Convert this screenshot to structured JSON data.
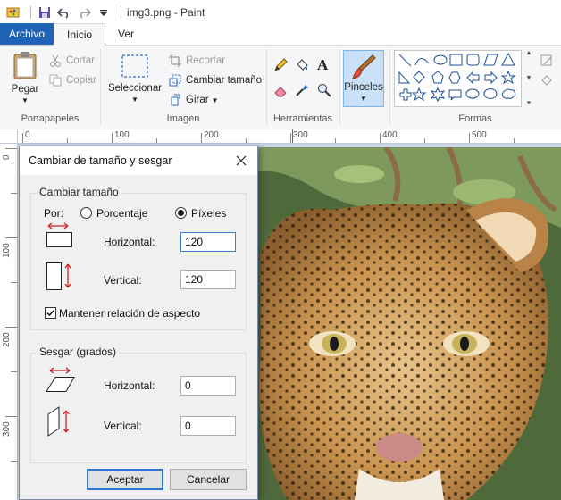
{
  "window": {
    "title": "img3.png - Paint"
  },
  "tabs": [
    {
      "label": "Archivo"
    },
    {
      "label": "Inicio"
    },
    {
      "label": "Ver"
    }
  ],
  "ribbon": {
    "clipboard": {
      "paste_label": "Pegar",
      "cut_label": "Cortar",
      "copy_label": "Copiar",
      "group_label": "Portapapeles"
    },
    "image": {
      "select_label": "Seleccionar",
      "crop_label": "Recortar",
      "resize_label": "Cambiar tamaño",
      "rotate_label": "Girar",
      "group_label": "Imagen"
    },
    "tools": {
      "group_label": "Herramientas"
    },
    "brushes": {
      "label": "Pinceles"
    },
    "shapes": {
      "group_label": "Formas"
    }
  },
  "rulers": {
    "top": [
      "0",
      "100",
      "200",
      "300",
      "400",
      "500"
    ],
    "left": [
      "0",
      "100",
      "200",
      "300"
    ]
  },
  "dialog": {
    "title": "Cambiar de tamaño y sesgar",
    "resize": {
      "legend": "Cambiar tamaño",
      "by_label": "Por:",
      "percent_label": "Porcentaje",
      "pixels_label": "Píxeles",
      "selected_unit": "Píxeles",
      "horizontal_label": "Horizontal:",
      "horizontal_value": "120",
      "vertical_label": "Vertical:",
      "vertical_value": "120",
      "keep_ratio_label": "Mantener relación de aspecto",
      "keep_ratio_checked": true
    },
    "skew": {
      "legend": "Sesgar (grados)",
      "horizontal_label": "Horizontal:",
      "horizontal_value": "0",
      "vertical_label": "Vertical:",
      "vertical_value": "0"
    },
    "ok_label": "Aceptar",
    "cancel_label": "Cancelar"
  },
  "colors": {
    "file_tab": "#1e63b6",
    "ribbon_bg": "#f5f6f7",
    "workarea_bg": "#c9d5e6",
    "resize_arrow": "#d42020",
    "default_button_border": "#2f74d0"
  }
}
